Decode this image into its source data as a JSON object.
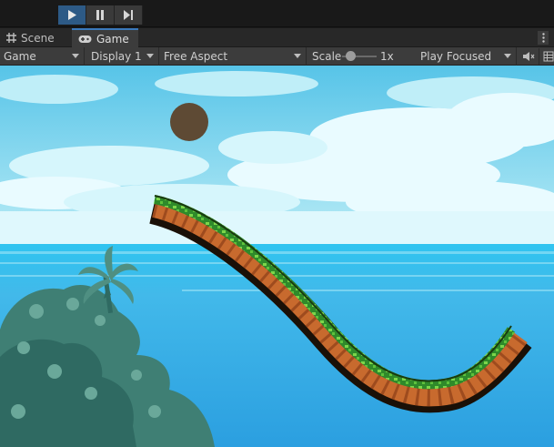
{
  "toolbar": {
    "play_state": "playing"
  },
  "tabs": [
    {
      "label": "Scene",
      "icon": "grid-icon",
      "active": false
    },
    {
      "label": "Game",
      "icon": "gamepad-icon",
      "active": true
    }
  ],
  "game_bar": {
    "view_mode": "Game",
    "display": "Display 1",
    "aspect": "Free Aspect",
    "scale_label": "Scale",
    "scale_value": "1x",
    "play_mode": "Play Focused"
  },
  "colors": {
    "play_active": "#2d5a86",
    "tab_accent": "#3a79bb",
    "sky": "#7fd6ef",
    "sea": "#3fb8e8",
    "ball": "#5e4a34",
    "dirt": "#c86a2e",
    "grass": "#3c9b2e",
    "foliage": "#3f7f74"
  }
}
